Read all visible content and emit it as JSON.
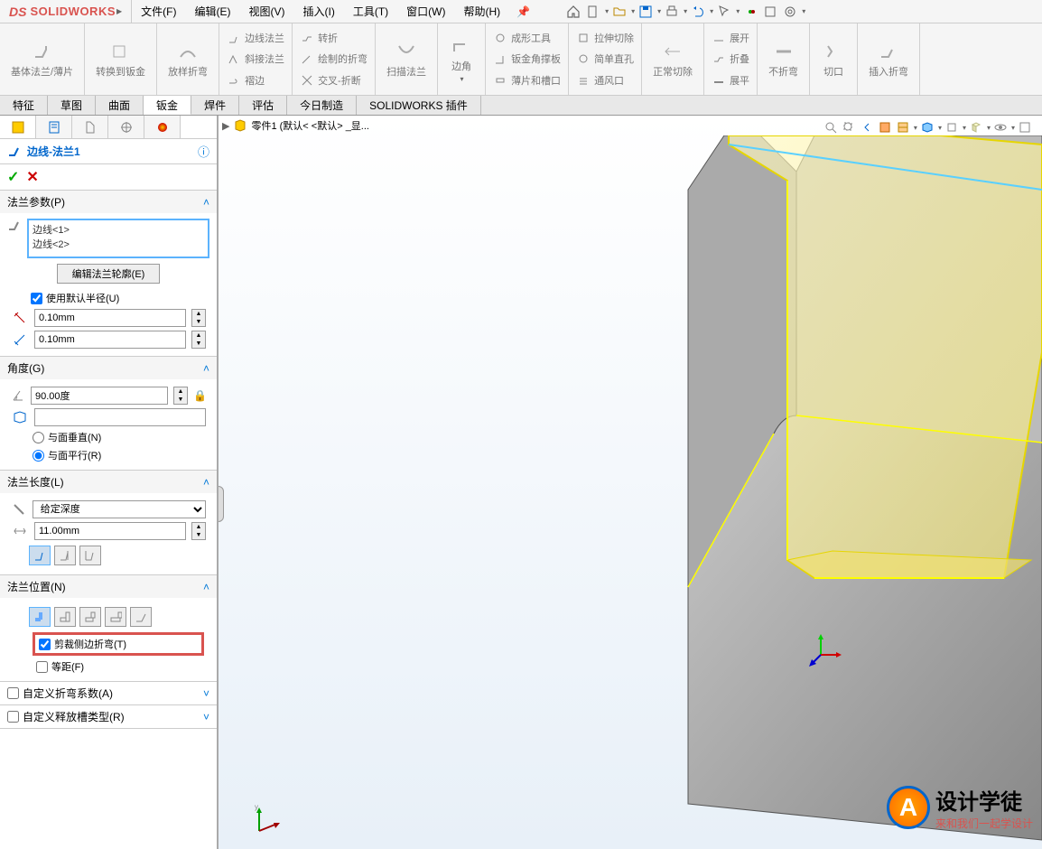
{
  "logo": {
    "ds": "DS",
    "text": "SOLIDWORKS"
  },
  "menus": {
    "file": "文件(F)",
    "edit": "编辑(E)",
    "view": "视图(V)",
    "insert": "插入(I)",
    "tools": "工具(T)",
    "window": "窗口(W)",
    "help": "帮助(H)"
  },
  "ribbon": {
    "base_flange": "基体法兰/薄片",
    "convert": "转换到钣金",
    "lofted_bend": "放样折弯",
    "edge_flange": "边线法兰",
    "miter_flange": "斜接法兰",
    "hem": "褶边",
    "jog": "转折",
    "sketched_bend": "绘制的折弯",
    "cross_break": "交叉-折断",
    "swept_flange": "扫描法兰",
    "corners": "边角",
    "forming_tool": "成形工具",
    "gusset": "钣金角撑板",
    "tab_slot": "薄片和槽口",
    "extruded_cut": "拉伸切除",
    "simple_hole": "简单直孔",
    "vent": "通风口",
    "normal_cut": "正常切除",
    "unfold": "展开",
    "fold": "折叠",
    "flatten": "展平",
    "no_bends": "不折弯",
    "rip": "切口",
    "insert_bends": "插入折弯"
  },
  "featureTabs": {
    "features": "特征",
    "sketch": "草图",
    "surface": "曲面",
    "sheetmetal": "钣金",
    "weldment": "焊件",
    "evaluate": "评估",
    "today": "今日制造",
    "plugins": "SOLIDWORKS 插件"
  },
  "breadcrumb": "零件1  (默认< <默认> _显...",
  "panel": {
    "title": "边线-法兰1",
    "sections": {
      "flangeParams": {
        "title": "法兰参数(P)",
        "edges": [
          "边线<1>",
          "边线<2>"
        ],
        "editProfile": "编辑法兰轮廓(E)",
        "useDefaultRadius": "使用默认半径(U)",
        "gap1": "0.10mm",
        "gap2": "0.10mm"
      },
      "angle": {
        "title": "角度(G)",
        "value": "90.00度",
        "perpendicular": "与面垂直(N)",
        "parallel": "与面平行(R)"
      },
      "flangeLength": {
        "title": "法兰长度(L)",
        "type": "给定深度",
        "value": "11.00mm"
      },
      "flangePosition": {
        "title": "法兰位置(N)",
        "trimSideBends": "剪裁侧边折弯(T)",
        "offset": "等距(F)"
      },
      "customBendAllowance": "自定义折弯系数(A)",
      "customRelief": "自定义释放槽类型(R)"
    }
  },
  "watermark": {
    "main": "设计学徒",
    "sub": "来和我们一起学设计"
  }
}
